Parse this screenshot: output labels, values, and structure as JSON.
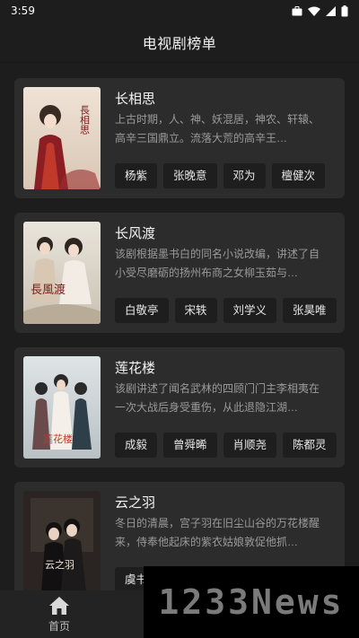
{
  "status_bar": {
    "time": "3:59"
  },
  "header": {
    "title": "电视剧榜单"
  },
  "dramas": [
    {
      "title": "长相思",
      "description": "上古时期，人、神、妖混居，神农、轩辕、高辛三国鼎立。流落大荒的高辛王…",
      "actors": [
        "杨紫",
        "张晚意",
        "邓为",
        "檀健次"
      ],
      "poster_text": "長相思"
    },
    {
      "title": "长风渡",
      "description": "该剧根据墨书白的同名小说改编，讲述了自小受尽磨砺的扬州布商之女柳玉茹与…",
      "actors": [
        "白敬亭",
        "宋轶",
        "刘学义",
        "张昊唯"
      ],
      "poster_text": "長風渡"
    },
    {
      "title": "莲花楼",
      "description": "该剧讲述了闻名武林的四顾门门主李相夷在一次大战后身受重伤，从此退隐江湖…",
      "actors": [
        "成毅",
        "曾舜晞",
        "肖顺尧",
        "陈都灵"
      ],
      "poster_text": "莲花楼"
    },
    {
      "title": "云之羽",
      "description": "冬日的清晨，宫子羽在旧尘山谷的万花楼醒来，侍奉他起床的紫衣姑娘敦促他抓…",
      "actors": [
        "虞书欣"
      ],
      "poster_text": "云之羽"
    }
  ],
  "bottom_nav": {
    "home_label": "首页"
  },
  "watermark": {
    "text": "1233News"
  },
  "colors": {
    "background": "#1d1d1d",
    "card": "#2c2c2c",
    "tag": "#1e1e1e"
  }
}
